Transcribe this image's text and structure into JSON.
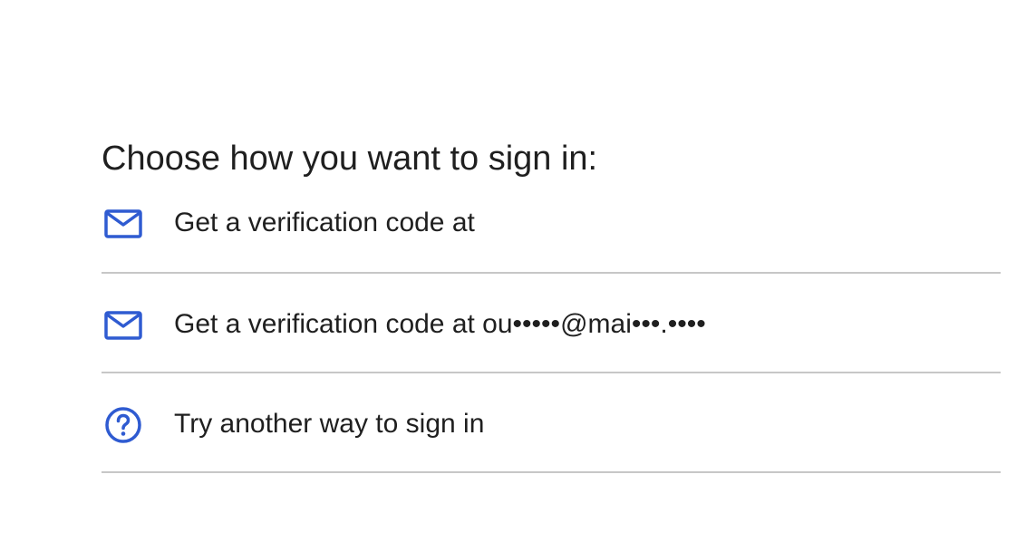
{
  "heading": "Choose how you want to sign in:",
  "options": [
    {
      "label": "Get a verification code at",
      "icon": "mail-icon"
    },
    {
      "label": "Get a verification code at ou•••••@mai•••.••••",
      "icon": "mail-icon"
    },
    {
      "label": "Try another way to sign in",
      "icon": "help-circle-icon"
    }
  ],
  "colors": {
    "accent": "#2f5bd1",
    "text": "#1f1f1f",
    "divider": "#c7c7c7"
  }
}
